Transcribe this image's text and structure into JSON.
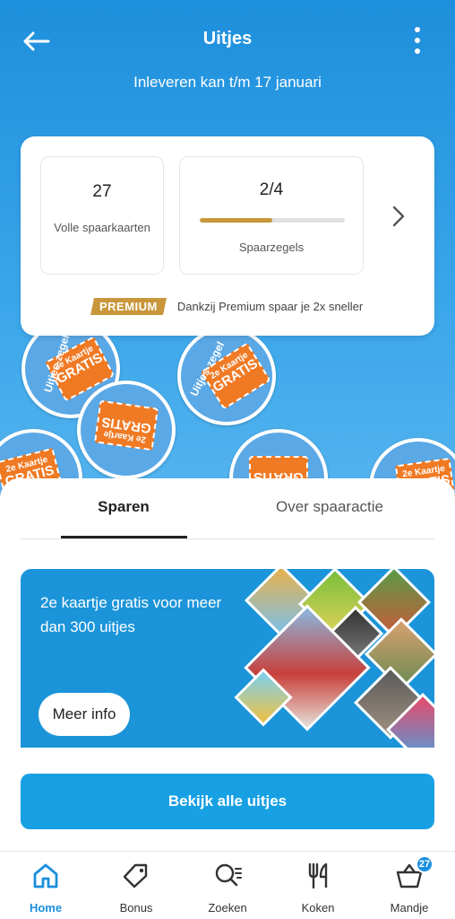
{
  "app_bar": {
    "title": "Uitjes",
    "subtitle": "Inleveren kan t/m 17 januari"
  },
  "savings_card": {
    "cards_count": "27",
    "cards_label": "Volle spaarkaarten",
    "stamps_value": "2/4",
    "stamps_progress": 0.5,
    "stamps_label": "Spaarzegels",
    "premium_badge": "PREMIUM",
    "premium_text": "Dankzij Premium spaar je 2x sneller"
  },
  "stickers": {
    "ring_text": "Uitjes-zegel",
    "ticket_line1": "2e Kaartje",
    "ticket_line2": "GRATIS"
  },
  "tabs": [
    {
      "label": "Sparen",
      "active": true
    },
    {
      "label": "Over spaaractie",
      "active": false
    }
  ],
  "banner": {
    "text": "2e kaartje gratis voor meer dan 300 uitjes",
    "button": "Meer info"
  },
  "cta": {
    "label": "Bekijk alle uitjes"
  },
  "bottom_nav": [
    {
      "label": "Home",
      "icon": "home-icon",
      "active": true
    },
    {
      "label": "Bonus",
      "icon": "tag-icon",
      "active": false
    },
    {
      "label": "Zoeken",
      "icon": "search-icon",
      "active": false
    },
    {
      "label": "Koken",
      "icon": "cutlery-icon",
      "active": false
    },
    {
      "label": "Mandje",
      "icon": "basket-icon",
      "active": false,
      "badge": "27"
    }
  ],
  "colors": {
    "primary": "#1a8fde",
    "premium": "#c9973b",
    "ticket": "#f07a24"
  }
}
